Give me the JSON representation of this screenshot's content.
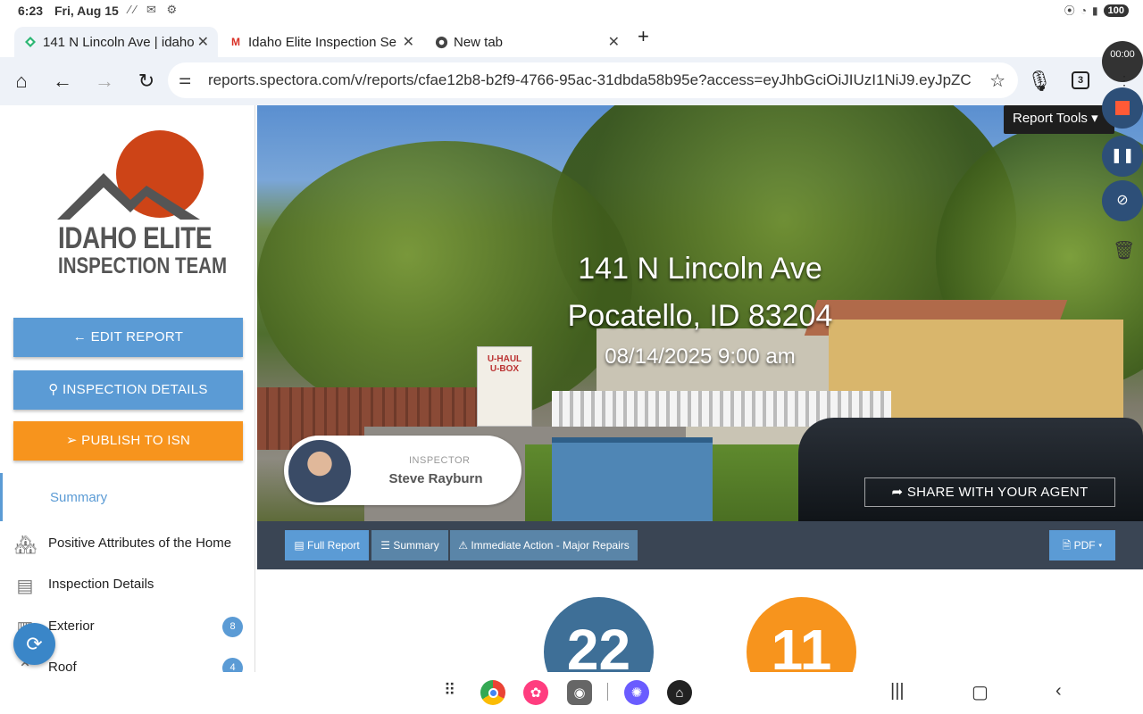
{
  "status_bar": {
    "time": "6:23",
    "date": "Fri, Aug 15",
    "battery": "100"
  },
  "browser": {
    "tabs": [
      {
        "title": "141 N Lincoln Ave | idaho",
        "favicon": "spectora-icon",
        "active": true
      },
      {
        "title": "Idaho Elite Inspection Se",
        "favicon": "gmail-icon",
        "active": false
      },
      {
        "title": "New tab",
        "favicon": "chrome-icon",
        "active": false
      }
    ],
    "url": "reports.spectora.com/v/reports/cfae12b8-b2f9-4766-95ac-31dbda58b95e?access=eyJhbGciOiJIUzI1NiJ9.eyJpZC",
    "tab_count": "3"
  },
  "sidebar": {
    "logo_line1": "IDAHO ELITE",
    "logo_line2": "INSPECTION TEAM",
    "buttons": {
      "edit": "EDIT REPORT",
      "details": "INSPECTION DETAILS",
      "publish": "PUBLISH TO ISN"
    },
    "summary_label": "Summary",
    "items": [
      {
        "label": "Positive Attributes of the Home",
        "icon": "house-icon",
        "badge": ""
      },
      {
        "label": "Inspection Details",
        "icon": "document-icon",
        "badge": ""
      },
      {
        "label": "Exterior",
        "icon": "fence-icon",
        "badge": "8"
      },
      {
        "label": "Roof",
        "icon": "roof-icon",
        "badge": "4"
      }
    ]
  },
  "hero": {
    "address_line1": "141 N Lincoln Ave",
    "address_line2": "Pocatello, ID 83204",
    "datetime": "08/14/2025 9:00 am",
    "inspector_label": "INSPECTOR",
    "inspector_name": "Steve Rayburn",
    "share_button": "SHARE WITH YOUR AGENT",
    "report_tools": "Report Tools"
  },
  "recorder": {
    "timer": "00:00"
  },
  "report_tabs": [
    {
      "label": "Full Report",
      "icon": "document-icon"
    },
    {
      "label": "Summary",
      "icon": "list-icon"
    },
    {
      "label": "Immediate Action - Major Repairs",
      "icon": "warning-icon"
    }
  ],
  "pdf_button": "PDF",
  "stats": {
    "count_1": "22",
    "count_2": "11"
  },
  "colors": {
    "accent_blue": "#5b9bd5",
    "accent_orange": "#f7941d",
    "sun_red": "#cd4417",
    "dark_blue_circle": "#3e6f97"
  }
}
